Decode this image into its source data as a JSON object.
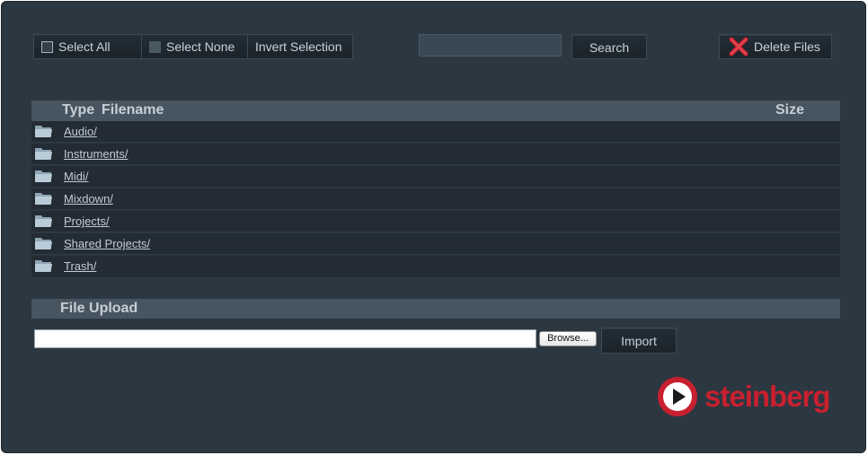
{
  "toolbar": {
    "select_all": "Select All",
    "select_none": "Select None",
    "invert_selection": "Invert Selection",
    "search_value": "",
    "search_button": "Search",
    "delete_button": "Delete Files"
  },
  "table": {
    "columns": [
      "Type",
      "Filename",
      "Size"
    ],
    "rows": [
      {
        "type_icon": "folder-icon",
        "name": "Audio/",
        "size": ""
      },
      {
        "type_icon": "folder-icon",
        "name": "Instruments/",
        "size": ""
      },
      {
        "type_icon": "folder-icon",
        "name": "Midi/",
        "size": ""
      },
      {
        "type_icon": "folder-icon",
        "name": "Mixdown/",
        "size": ""
      },
      {
        "type_icon": "folder-icon",
        "name": "Projects/",
        "size": ""
      },
      {
        "type_icon": "folder-icon",
        "name": "Shared Projects/",
        "size": ""
      },
      {
        "type_icon": "folder-icon",
        "name": "Trash/",
        "size": ""
      }
    ]
  },
  "upload": {
    "title": "File Upload",
    "file_value": "",
    "browse_button": "Browse...",
    "import_button": "Import"
  },
  "brand": {
    "logo_text": "steinberg",
    "color": "#c8202f"
  },
  "colors": {
    "panel_bg": "#2b3741",
    "header_bg": "#475560",
    "row_bg": "#232c34",
    "delete_icon": "#c8202f"
  }
}
